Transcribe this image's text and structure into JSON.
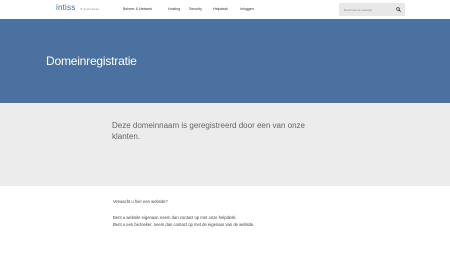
{
  "header": {
    "logo": "intiss",
    "tagline": "IT & ab Hoster",
    "nav": [
      "Beheer & Netwerk",
      "Hosting",
      "Security",
      "Helpdesk",
      "Inloggen"
    ],
    "search_placeholder": "Doorzoek de website"
  },
  "hero": {
    "title": "Domeinregistratie"
  },
  "notice": {
    "text": "Deze domeinnaam is geregistreerd door een van onze klanten."
  },
  "info": {
    "question": "Verwacht u hier een website?",
    "line_owner": "Bent u website eigenaar, neem dan contact op met onze helpdesk.",
    "line_visitor": "Bent u een bezoeker, neem dan contact op met de eigenaar van de website."
  },
  "colors": {
    "hero_bg": "#4b71a1",
    "notice_bg": "#ececec"
  }
}
